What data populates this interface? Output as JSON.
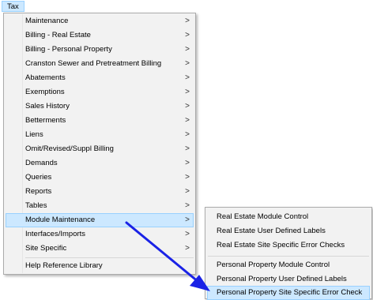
{
  "menubar": {
    "tax_label": "Tax"
  },
  "main_menu": {
    "items": [
      {
        "label": "Maintenance",
        "arrow": ">"
      },
      {
        "label": "Billing - Real Estate",
        "arrow": ">"
      },
      {
        "label": "Billing - Personal Property",
        "arrow": ">"
      },
      {
        "label": "Cranston Sewer and Pretreatment Billing",
        "arrow": ">"
      },
      {
        "label": "Abatements",
        "arrow": ">"
      },
      {
        "label": "Exemptions",
        "arrow": ">"
      },
      {
        "label": "Sales History",
        "arrow": ">"
      },
      {
        "label": "Betterments",
        "arrow": ">"
      },
      {
        "label": "Liens",
        "arrow": ">"
      },
      {
        "label": "Omit/Revised/Suppl Billing",
        "arrow": ">"
      },
      {
        "label": "Demands",
        "arrow": ">"
      },
      {
        "label": "Queries",
        "arrow": ">"
      },
      {
        "label": "Reports",
        "arrow": ">"
      },
      {
        "label": "Tables",
        "arrow": ">"
      },
      {
        "label": "Module Maintenance",
        "arrow": ">"
      },
      {
        "label": "Interfaces/Imports",
        "arrow": ">"
      },
      {
        "label": "Site Specific",
        "arrow": ">"
      }
    ],
    "help_item": "Help Reference Library"
  },
  "sub_menu": {
    "items": [
      "Real Estate Module Control",
      "Real Estate User Defined Labels",
      "Real Estate Site Specific Error Checks",
      "Personal Property Module Control",
      "Personal Property User Defined Labels",
      "Personal Property Site Specific Error Check"
    ]
  },
  "colors": {
    "menu_background": "#f2f2f2",
    "highlight_fill": "#cce8ff",
    "highlight_border": "#99d1ff",
    "annotation_arrow": "#1a22e6"
  }
}
